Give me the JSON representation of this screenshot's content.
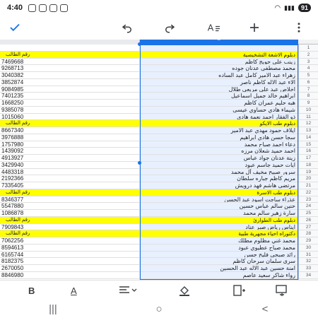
{
  "status": {
    "time": "4:40",
    "battery": "91"
  },
  "toolbar": {
    "confirm_icon": "checkmark-icon",
    "undo_icon": "undo-icon",
    "redo_icon": "redo-icon",
    "text_format_icon": "text-format-icon",
    "insert_icon": "plus-icon",
    "more_icon": "more-vertical-icon"
  },
  "sheet": {
    "column_header_b": "B",
    "rows": [
      {
        "n": "1",
        "a": "",
        "b": "",
        "hdr": false
      },
      {
        "n": "2",
        "a": "رقم الطالب",
        "b": "دبلوم الاشعة التشخيصية",
        "hdr": true
      },
      {
        "n": "3",
        "a": "7469668",
        "b": "زينب علي حويج كاظم",
        "hdr": false
      },
      {
        "n": "4",
        "a": "9268713",
        "b": "محمد مصطفى عدنان جوده",
        "hdr": false
      },
      {
        "n": "5",
        "a": "3040382",
        "b": "زهراء عبد الامير كامل عبد الساده",
        "hdr": false
      },
      {
        "n": "6",
        "a": "3852874",
        "b": "الاء عبد الاله كاظم ناصر",
        "hdr": false
      },
      {
        "n": "7",
        "a": "9084985",
        "b": "اخلاص عبد علي مريعي طلال",
        "hdr": false
      },
      {
        "n": "8",
        "a": "7401235",
        "b": "ابراهيم خالد جميل اسماعيل",
        "hdr": false
      },
      {
        "n": "9",
        "a": "1668250",
        "b": "هبه حليم عمران كاظم",
        "hdr": false
      },
      {
        "n": "10",
        "a": "9385078",
        "b": "شيماء هادي حساوي عيسى",
        "hdr": false
      },
      {
        "n": "11",
        "a": "1015060",
        "b": "ذو الفقار احمد نعمة هادي",
        "hdr": false
      },
      {
        "n": "12",
        "a": "رقم الطالب",
        "b": "دبلوم طب الايكو",
        "hdr": true
      },
      {
        "n": "13",
        "a": "8667340",
        "b": "ايلاف حمود مهدي عبد الامير",
        "hdr": false
      },
      {
        "n": "14",
        "a": "3976888",
        "b": "سجا حسن هادي ابراهيم",
        "hdr": false
      },
      {
        "n": "15",
        "a": "1757980",
        "b": "دعاء احمد صباح محمد",
        "hdr": false
      },
      {
        "n": "16",
        "a": "1439092",
        "b": "احمد حميد شعلان مرزه",
        "hdr": false
      },
      {
        "n": "17",
        "a": "4913927",
        "b": "زينة عدنان جواد عباس",
        "hdr": false
      },
      {
        "n": "18",
        "a": "3429940",
        "b": "ايات حميد جاسم عبود",
        "hdr": false
      },
      {
        "n": "19",
        "a": "4483318",
        "b": "سرور صبيح مخيف آل محمد",
        "hdr": false
      },
      {
        "n": "20",
        "a": "2192366",
        "b": "مريم كاظم جباره سلطان",
        "hdr": false
      },
      {
        "n": "21",
        "a": "7335405",
        "b": "مرتضى هاشم فهد درويش",
        "hdr": false
      },
      {
        "n": "22",
        "a": "رقم الطالب",
        "b": "دبلوم طب الاسرة",
        "hdr": true
      },
      {
        "n": "23",
        "a": "8346377",
        "b": "عذراء ساجت اسود عبد الحسن",
        "hdr": false
      },
      {
        "n": "24",
        "a": "5547880",
        "b": "حنين سالم عباس حسين",
        "hdr": false
      },
      {
        "n": "25",
        "a": "1086878",
        "b": "سارة زهير سالم محمد",
        "hdr": false
      },
      {
        "n": "26",
        "a": "رقم الطالب",
        "b": "دبلوم طب الطوارئ",
        "hdr": true
      },
      {
        "n": "27",
        "a": "7909843",
        "b": "ايناس رياض صبر عناد",
        "hdr": false
      },
      {
        "n": "28",
        "a": "رقم الطالب",
        "b": "دكتوراه احياء مجهرية طبية",
        "hdr": true
      },
      {
        "n": "29",
        "a": "7062256",
        "b": "محمد غني مظلوم مطلك",
        "hdr": false
      },
      {
        "n": "30",
        "a": "8594613",
        "b": "محمد صباح عطيوي عبود",
        "hdr": false
      },
      {
        "n": "31",
        "a": "6165744",
        "b": "رائد صبحي فليح حسن",
        "hdr": false
      },
      {
        "n": "32",
        "a": "8182375",
        "b": "سرى سلمان سرحان كاظم",
        "hdr": false
      },
      {
        "n": "33",
        "a": "2670050",
        "b": "امنة حسين عبد الاله عبد الحسين",
        "hdr": false
      },
      {
        "n": "34",
        "a": "8846980",
        "b": "رواء شاكر سعيد عاصم",
        "hdr": false
      },
      {
        "n": "35",
        "a": "7884435",
        "b": "نادية عبد العباس كاظم ناجي",
        "hdr": false
      },
      {
        "n": "36",
        "a": "1655135",
        "b": "فاطمة ناصر حسين دجام",
        "hdr": false
      },
      {
        "n": "37",
        "a": "9890824",
        "b": "هديل قاسم جبر ادريس",
        "hdr": false
      },
      {
        "n": "38",
        "a": "2940523",
        "b": "زيد كاظم محمد علي عباس",
        "hdr": false
      }
    ]
  },
  "format_bar": {
    "bold_label": "B",
    "text_color_label": "A",
    "align_icon": "align-icon",
    "fill_icon": "fill-color-icon",
    "insert_col_icon": "insert-column-icon",
    "insert_row_icon": "insert-row-icon"
  },
  "nav": {
    "recents": "|||",
    "home": "○",
    "back": "<"
  }
}
